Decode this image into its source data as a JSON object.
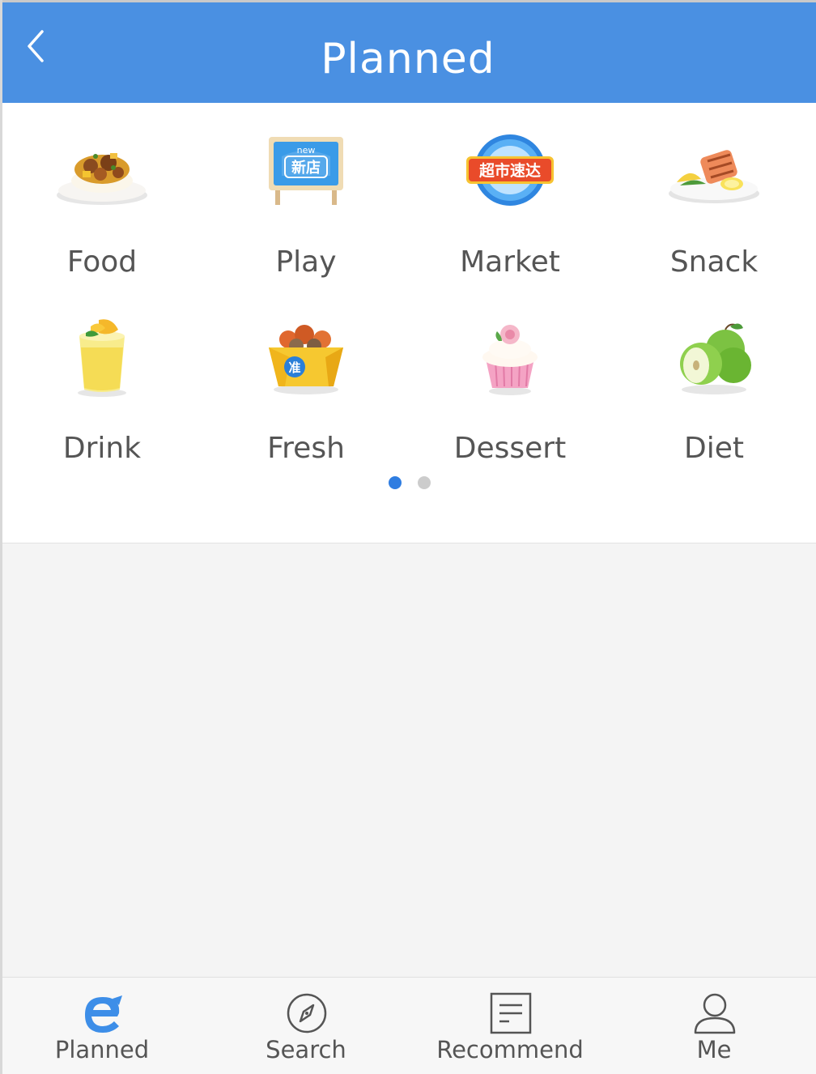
{
  "header": {
    "title": "Planned",
    "back_icon": "chevron-left-icon",
    "background_color": "#4a90e2"
  },
  "categories": [
    {
      "label": "Food",
      "icon": "curry-plate-icon"
    },
    {
      "label": "Play",
      "icon": "new-store-board-icon"
    },
    {
      "label": "Market",
      "icon": "market-express-badge-icon"
    },
    {
      "label": "Snack",
      "icon": "salmon-plate-icon"
    },
    {
      "label": "Drink",
      "icon": "mango-drink-icon"
    },
    {
      "label": "Fresh",
      "icon": "seafood-box-icon"
    },
    {
      "label": "Dessert",
      "icon": "cupcake-icon"
    },
    {
      "label": "Diet",
      "icon": "green-apple-icon"
    }
  ],
  "store_board_text": {
    "top": "new",
    "main": "新店"
  },
  "market_badge_text": "超市速达",
  "fresh_box_text": "准",
  "pagination": {
    "current": 1,
    "total": 2,
    "active_color": "#2f7de1",
    "inactive_color": "#cccccc"
  },
  "bottom_nav": {
    "active_color": "#3d8ee8",
    "items": [
      {
        "label": "Planned",
        "icon": "e-logo-icon",
        "active": true
      },
      {
        "label": "Search",
        "icon": "compass-icon",
        "active": false
      },
      {
        "label": "Recommend",
        "icon": "document-list-icon",
        "active": false
      },
      {
        "label": "Me",
        "icon": "person-icon",
        "active": false
      }
    ]
  }
}
